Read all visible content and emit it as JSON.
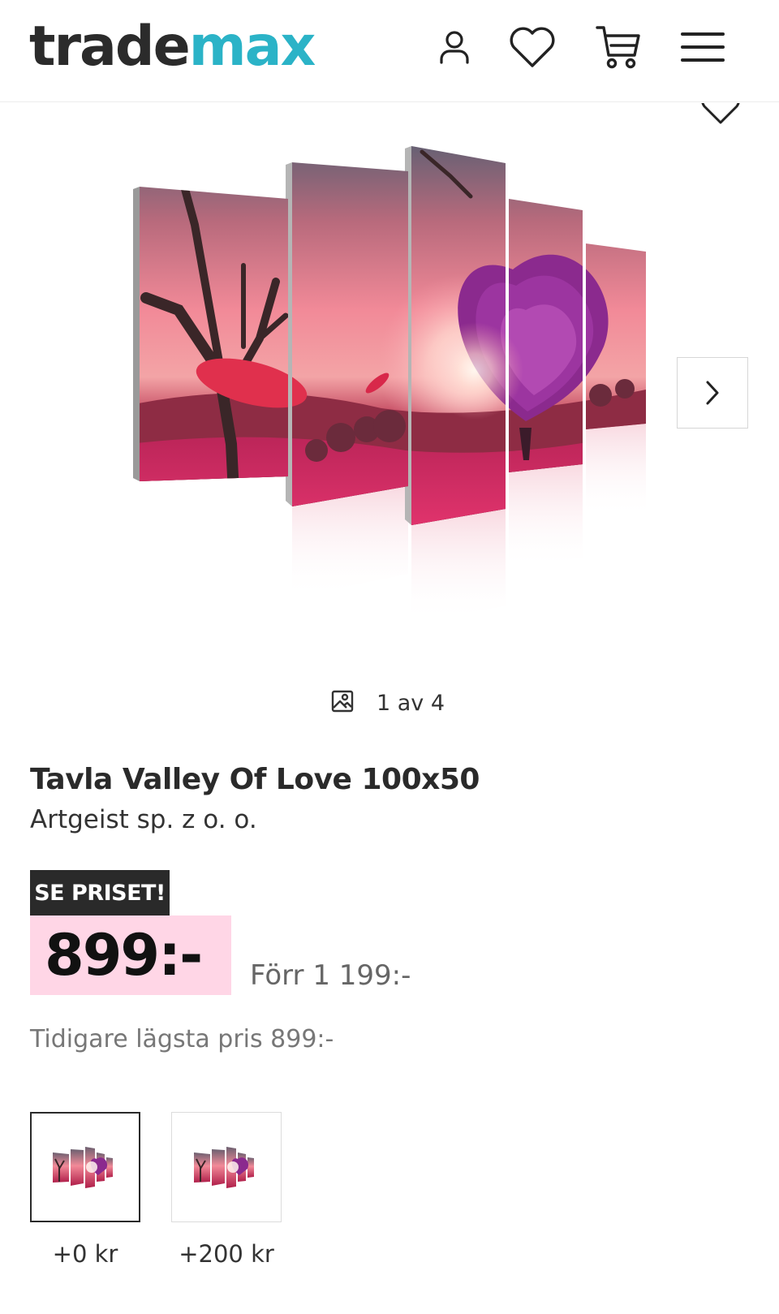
{
  "header": {
    "logo_part1": "trade",
    "logo_part2": "max",
    "icons": [
      "account-icon",
      "wishlist-icon",
      "cart-icon",
      "menu-icon"
    ]
  },
  "gallery": {
    "counter": "1 av 4",
    "icons": [
      "favorite-icon",
      "chevron-right-icon",
      "image-icon"
    ]
  },
  "product": {
    "title": "Tavla Valley Of Love 100x50",
    "brand": "Artgeist sp. z o. o.",
    "badge": "SE PRISET!",
    "price": "899:-",
    "old_price": "Förr 1 199:-",
    "lowest_price": "Tidigare lägsta pris 899:-"
  },
  "variants": [
    {
      "label": "+0 kr",
      "selected": true
    },
    {
      "label": "+200 kr",
      "selected": false
    }
  ],
  "colors": {
    "logo_dark": "#2b2b2b",
    "logo_accent": "#2bb3c7",
    "badge_bg": "#2a2a2a",
    "price_highlight": "#ffd6e6"
  }
}
